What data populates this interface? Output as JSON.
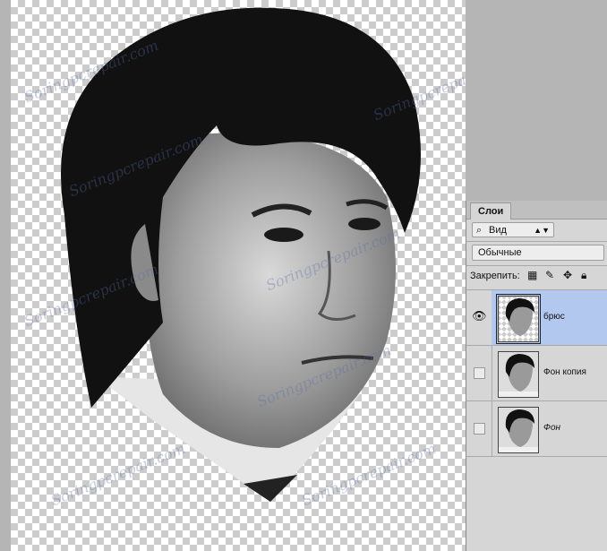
{
  "watermark_text": "Soringpcrepair.com",
  "layers_panel": {
    "tab_label": "Слои",
    "filter_kind": "Вид",
    "blend_mode": "Обычные",
    "lock_label": "Закрепить:",
    "layers": [
      {
        "name": "брюс",
        "visible": true,
        "selected": true,
        "italic": false
      },
      {
        "name": "Фон копия",
        "visible": false,
        "selected": false,
        "italic": false
      },
      {
        "name": "Фон",
        "visible": false,
        "selected": false,
        "italic": true
      }
    ]
  },
  "colors": {
    "selection": "#b3c8ef",
    "panel_bg": "#d6d6d6",
    "checker_dark": "#cccccc"
  },
  "icons": [
    "magnifier-icon",
    "dropdown-arrow-icon",
    "lock-transparent-icon",
    "lock-brush-icon",
    "lock-move-icon",
    "lock-all-icon",
    "eye-icon"
  ]
}
